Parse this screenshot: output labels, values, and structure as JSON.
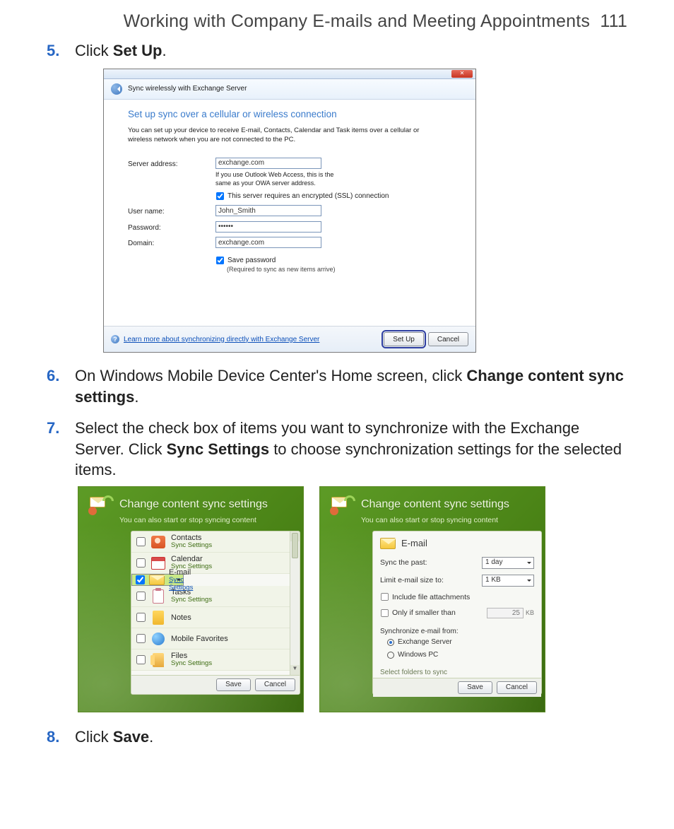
{
  "header": {
    "title": "Working with Company E-mails and Meeting Appointments",
    "page_no": "111"
  },
  "steps": {
    "s5": {
      "num": "5.",
      "pre": "Click ",
      "bold": "Set Up",
      "post": "."
    },
    "s6": {
      "num": "6.",
      "pre": "On Windows Mobile Device Center's Home screen, click ",
      "bold": "Change content sync settings",
      "post": "."
    },
    "s7": {
      "num": "7.",
      "pre": "Select the check box of items you want to synchronize with the Exchange Server. Click ",
      "bold": "Sync Settings",
      "post": " to choose synchronization settings for the selected items."
    },
    "s8": {
      "num": "8.",
      "pre": "Click ",
      "bold": "Save",
      "post": "."
    }
  },
  "dlg1": {
    "close_glyph": "✕",
    "subbar": "Sync wirelessly with Exchange Server",
    "heading": "Set up sync over a cellular or wireless connection",
    "desc": "You can set up your device to receive E-mail, Contacts, Calendar and Task items over a cellular or wireless network when you are not connected to the PC.",
    "labels": {
      "server": "Server address:",
      "user": "User name:",
      "pass": "Password:",
      "domain": "Domain:"
    },
    "values": {
      "server": "exchange.com",
      "user": "John_Smith",
      "pass": "••••••",
      "domain": "exchange.com"
    },
    "hint_server": "If you use Outlook Web Access, this is the same as your OWA server address.",
    "ssl": "This server requires an encrypted (SSL) connection",
    "savepw": "Save password",
    "savepw_req": "(Required to sync as new items arrive)",
    "learn": "Learn more about synchronizing directly with Exchange Server",
    "q": "?",
    "btn_setup": "Set Up",
    "btn_cancel": "Cancel"
  },
  "greens": {
    "title": "Change content sync settings",
    "subtitle": "You can also start or stop syncing content",
    "sync_settings": "Sync Settings",
    "items": [
      {
        "name": "Contacts",
        "ss": true
      },
      {
        "name": "Calendar",
        "ss": true
      },
      {
        "name": "E-mail",
        "ss": true,
        "selected": true,
        "checked": true
      },
      {
        "name": "Tasks",
        "ss": true
      },
      {
        "name": "Notes",
        "ss": false
      },
      {
        "name": "Mobile Favorites",
        "ss": false
      },
      {
        "name": "Files",
        "ss": true
      }
    ],
    "save": "Save",
    "cancel": "Cancel",
    "scroll_up": "▲",
    "scroll_down": "▼"
  },
  "email": {
    "section": "E-mail",
    "sync_past_label": "Sync the past:",
    "sync_past_value": "1 day",
    "limit_label": "Limit e-mail size to:",
    "limit_value": "1 KB",
    "include_attach": "Include file attachments",
    "only_if": "Only if smaller than",
    "only_if_value": "25",
    "kb": "KB",
    "sync_from": "Synchronize e-mail from:",
    "opt1": "Exchange Server",
    "opt2": "Windows PC",
    "folders": "Select folders to sync",
    "save": "Save",
    "cancel": "Cancel"
  }
}
